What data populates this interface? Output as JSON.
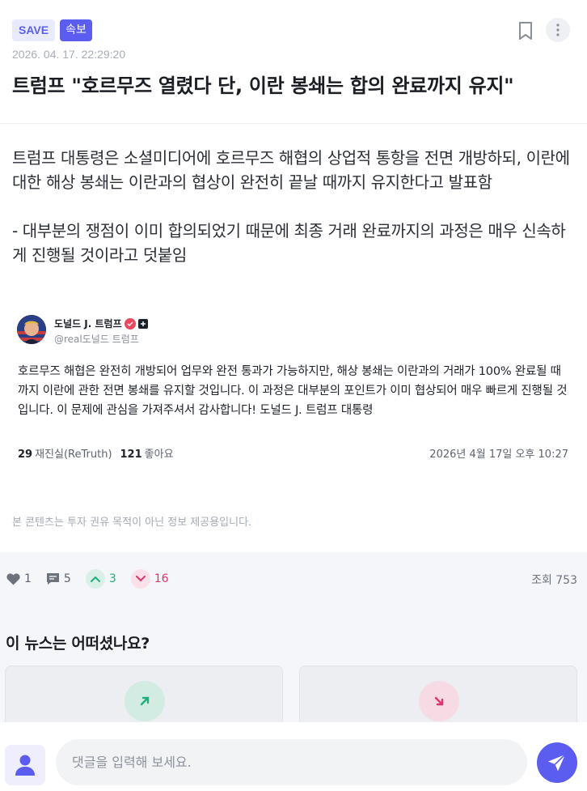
{
  "header": {
    "save_label": "SAVE",
    "breaking_label": "속보",
    "timestamp": "2026. 04. 17. 22:29:20",
    "headline": "트럼프 \"호르무즈 열렸다 단, 이란 봉쇄는 합의 완료까지 유지\""
  },
  "article": {
    "paragraph1": "트럼프 대통령은 소셜미디어에 호르무즈 해협의 상업적 통항을 전면 개방하되, 이란에 대한 해상 봉쇄는 이란과의 협상이 완전히 끝날 때까지 유지한다고 발표함",
    "paragraph2": "- 대부분의 쟁점이 이미 합의되었기 때문에 최종 거래 완료까지의 과정은 매우 신속하게 진행될 것이라고 덧붙임"
  },
  "embed": {
    "author_name": "도널드 J. 트럼프",
    "author_handle": "@real도널드 트럼프",
    "text": "호르무즈 해협은 완전히 개방되어 업무와 완전 통과가 가능하지만, 해상 봉쇄는 이란과의 거래가 100% 완료될 때까지 이란에 관한 전면 봉쇄를 유지할 것입니다. 이 과정은 대부분의 포인트가 이미 협상되어 매우 빠르게 진행될 것입니다. 이 문제에 관심을 가져주셔서 감사합니다! 도널드 J. 트럼프 대통령",
    "retruth_count": "29",
    "retruth_label": "재진실(ReTruth)",
    "like_count": "121",
    "like_label": "좋아요",
    "date": "2026년 4월 17일 오후 10:27"
  },
  "disclaimer": "본 콘텐츠는 투자 권유 목적이 아닌 정보 제공용입니다.",
  "actions": {
    "likes": "1",
    "comments": "5",
    "up_votes": "3",
    "down_votes": "16",
    "views": "조회 753"
  },
  "poll": {
    "question": "이 뉴스는 어떠셨나요?"
  },
  "comment": {
    "placeholder": "댓글을 입력해 보세요."
  },
  "colors": {
    "accent": "#5b5cf0",
    "up": "#1fae7a",
    "down": "#e0336b"
  },
  "icons": [
    "bookmark-icon",
    "more-vertical-icon",
    "verified-icon",
    "plus-icon",
    "heart-icon",
    "comment-icon",
    "chevron-up-icon",
    "chevron-down-icon",
    "arrow-up-right-icon",
    "arrow-down-right-icon",
    "user-icon",
    "send-icon"
  ]
}
